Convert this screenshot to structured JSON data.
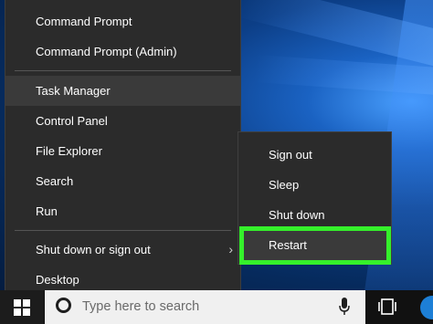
{
  "power_menu": {
    "items": [
      {
        "label": "Command Prompt"
      },
      {
        "label": "Command Prompt (Admin)"
      },
      {
        "label": "Task Manager"
      },
      {
        "label": "Control Panel"
      },
      {
        "label": "File Explorer"
      },
      {
        "label": "Search"
      },
      {
        "label": "Run"
      },
      {
        "label": "Shut down or sign out",
        "icon": "chevron-right-icon"
      },
      {
        "label": "Desktop"
      }
    ]
  },
  "shutdown_submenu": {
    "items": [
      {
        "label": "Sign out"
      },
      {
        "label": "Sleep"
      },
      {
        "label": "Shut down"
      },
      {
        "label": "Restart"
      }
    ],
    "highlighted_item": "Restart",
    "highlight_color": "#35f02b"
  },
  "taskbar": {
    "search_placeholder": "Type here to search",
    "icons": [
      "windows-start-icon",
      "cortana-icon",
      "microphone-icon",
      "task-view-icon",
      "edge-icon"
    ]
  },
  "colors": {
    "menu_background": "#2b2b2b",
    "menu_hover": "#3a3a3a",
    "taskbar": "#111111"
  }
}
